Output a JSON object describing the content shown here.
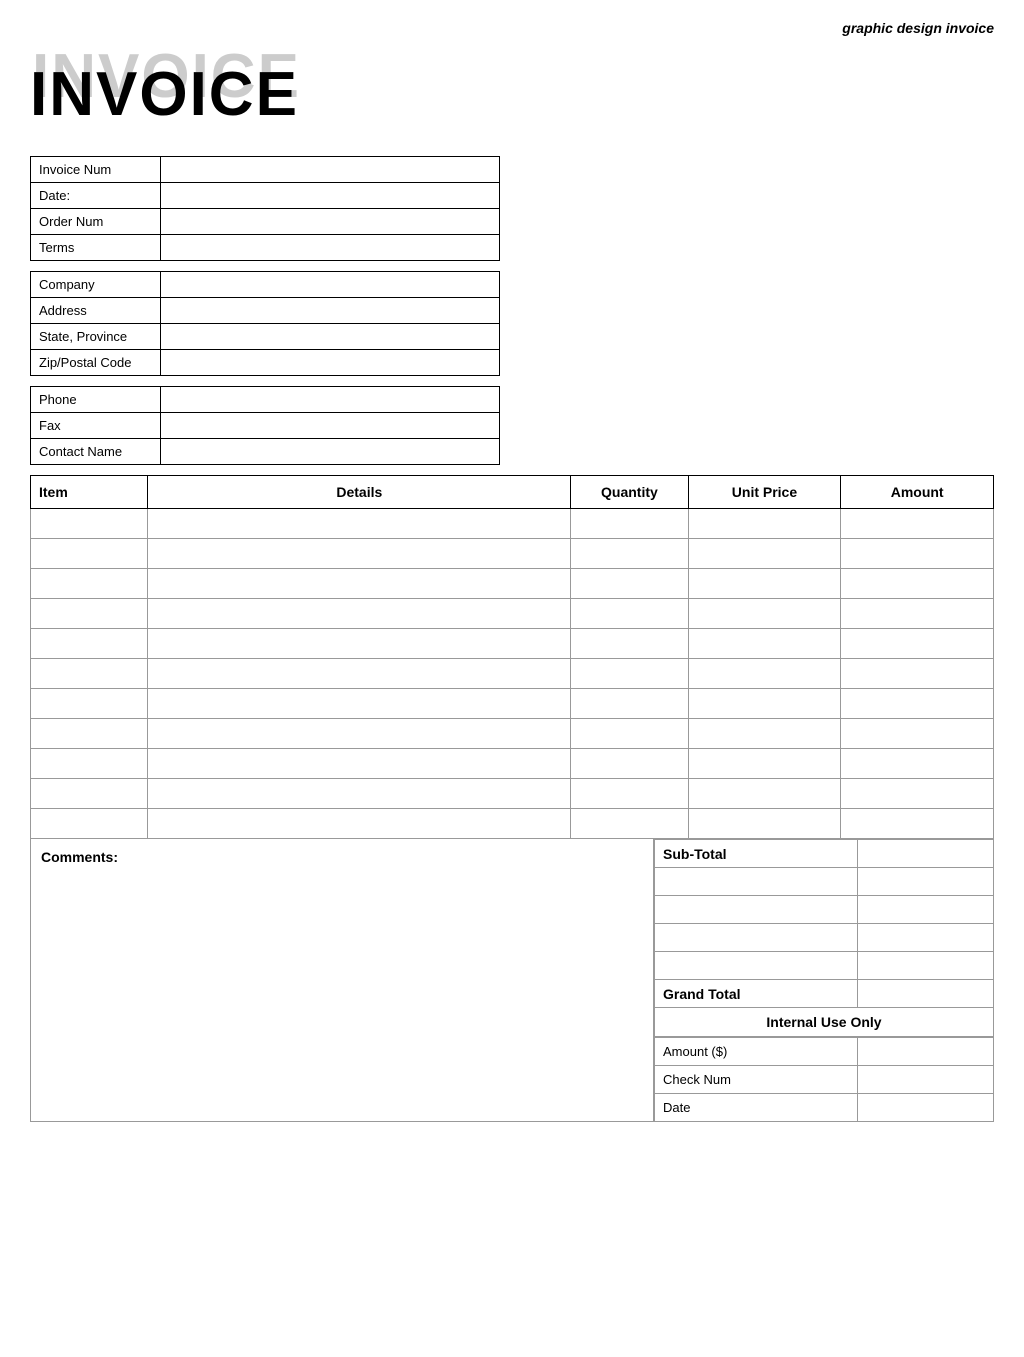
{
  "header": {
    "graphic_design_label": "graphic design invoice"
  },
  "invoice_title": {
    "shadow": "INVOICE",
    "main": "INVOICE"
  },
  "invoice_info": {
    "fields": [
      {
        "label": "Invoice Num",
        "value": ""
      },
      {
        "label": "Date:",
        "value": ""
      },
      {
        "label": "Order Num",
        "value": ""
      },
      {
        "label": "Terms",
        "value": ""
      }
    ]
  },
  "company_info": {
    "fields": [
      {
        "label": "Company",
        "value": ""
      },
      {
        "label": "Address",
        "value": ""
      },
      {
        "label": "State, Province",
        "value": ""
      },
      {
        "label": "Zip/Postal Code",
        "value": ""
      }
    ]
  },
  "contact_info": {
    "fields": [
      {
        "label": "Phone",
        "value": ""
      },
      {
        "label": "Fax",
        "value": ""
      },
      {
        "label": "Contact Name",
        "value": ""
      }
    ]
  },
  "table": {
    "headers": {
      "item": "Item",
      "details": "Details",
      "quantity": "Quantity",
      "unit_price": "Unit Price",
      "amount": "Amount"
    },
    "rows": 11
  },
  "comments": {
    "label": "Comments:"
  },
  "totals": {
    "subtotal_label": "Sub-Total",
    "subtotal_value": "",
    "extra_rows": [
      "",
      "",
      "",
      ""
    ],
    "grand_total_label": "Grand Total",
    "grand_total_value": "",
    "internal_use_label": "Internal Use Only",
    "internal_fields": [
      {
        "label": "Amount ($)",
        "value": ""
      },
      {
        "label": "Check Num",
        "value": ""
      },
      {
        "label": "Date",
        "value": ""
      }
    ]
  }
}
